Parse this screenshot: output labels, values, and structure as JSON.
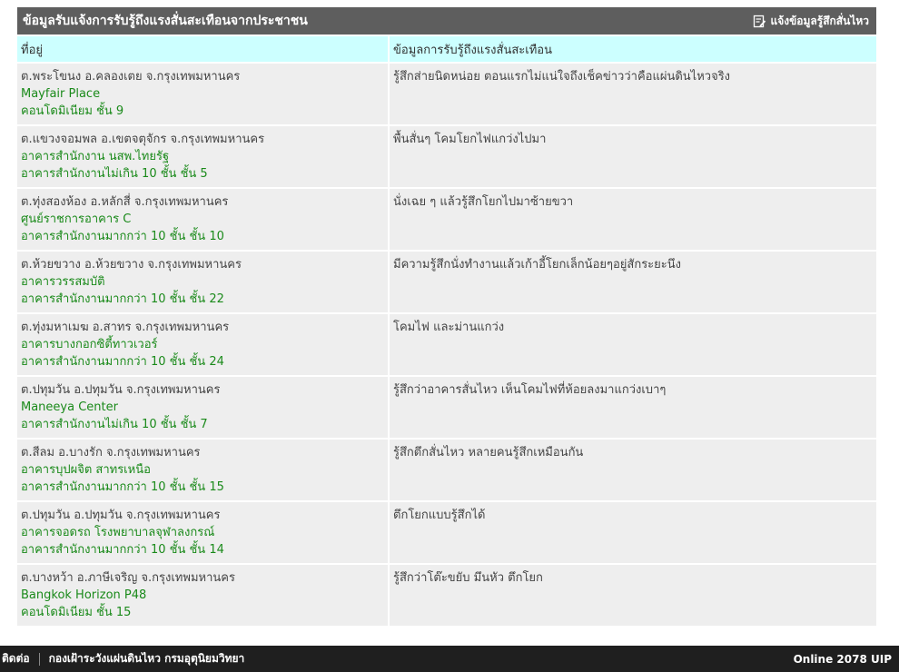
{
  "panel": {
    "title": "ข้อมูลรับแจ้งการรับรู้ถึงแรงสั่นสะเทือนจากประชาชน",
    "report_link_label": "แจ้งข้อมูลรู้สึกสั่นไหว",
    "report_link_icon": "edit-note-icon"
  },
  "table": {
    "headers": {
      "address": "ที่อยู่",
      "info": "ข้อมูลการรับรู้ถึงแรงสั่นสะเทือน"
    },
    "rows": [
      {
        "district": "ต.พระโขนง อ.คลองเตย จ.กรุงเทพมหานคร",
        "building": "Mayfair Place",
        "floor": "คอนโดมิเนียม ชั้น 9",
        "info": "รู้สึกส่ายนิดหน่อย ตอนแรกไม่แน่ใจถึงเช็คข่าวว่าคือแผ่นดินไหวจริง"
      },
      {
        "district": "ต.แขวงจอมพล อ.เขตจตุจักร จ.กรุงเทพมหานคร",
        "building": "อาคารสำนักงาน นสพ.ไทยรัฐ",
        "floor": "อาคารสำนักงานไม่เกิน 10 ชั้น ชั้น 5",
        "info": "พื้นสั่นๆ โคมโยกไฟแกว่งไปมา"
      },
      {
        "district": "ต.ทุ่งสองห้อง อ.หลักสี่ จ.กรุงเทพมหานคร",
        "building": "ศูนย์ราชการอาคาร C",
        "floor": "อาคารสำนักงานมากกว่า 10 ชั้น ชั้น 10",
        "info": "นั่งเฉย ๆ แล้วรู้สึกโยกไปมาซ้ายขวา"
      },
      {
        "district": "ต.ห้วยขวาง อ.ห้วยขวาง จ.กรุงเทพมหานคร",
        "building": "อาคารวรรสมบัติ",
        "floor": "อาคารสำนักงานมากกว่า 10 ชั้น ชั้น 22",
        "info": "มีความรู้สึกนั่งทำงานแล้วเก้าอี้โยกเล็กน้อยๆอยู่สักระยะนึง"
      },
      {
        "district": "ต.ทุ่งมหาเมฆ อ.สาทร จ.กรุงเทพมหานคร",
        "building": "อาคารบางกอกซิตี้ทาวเวอร์",
        "floor": "อาคารสำนักงานมากกว่า 10 ชั้น ชั้น 24",
        "info": "โคมไฟ และม่านแกว่ง"
      },
      {
        "district": "ต.ปทุมวัน อ.ปทุมวัน จ.กรุงเทพมหานคร",
        "building": "Maneeya Center",
        "floor": "อาคารสำนักงานไม่เกิน 10 ชั้น ชั้น 7",
        "info": "รู้สึกว่าอาคารสั่นไหว เห็นโคมไฟที่ห้อยลงมาแกว่งเบาๆ"
      },
      {
        "district": "ต.สีลม อ.บางรัก จ.กรุงเทพมหานคร",
        "building": "อาคารบุปผจิต สาทรเหนือ",
        "floor": "อาคารสำนักงานมากกว่า 10 ชั้น ชั้น 15",
        "info": "รู้สึกตึกสั่นไหว หลายคนรู้สึกเหมือนกัน"
      },
      {
        "district": "ต.ปทุมวัน อ.ปทุมวัน จ.กรุงเทพมหานคร",
        "building": "อาคารจอดรถ โรงพยาบาลจุฬาลงกรณ์",
        "floor": "อาคารสำนักงานมากกว่า 10 ชั้น ชั้น 14",
        "info": "ตึกโยกแบบรู้สึกได้"
      },
      {
        "district": "ต.บางหว้า อ.ภาษีเจริญ จ.กรุงเทพมหานคร",
        "building": "Bangkok Horizon P48",
        "floor": "คอนโดมิเนียม ชั้น 15",
        "info": "รู้สึกว่าโต๊ะขยับ มึนหัว ตึกโยก"
      }
    ]
  },
  "footer": {
    "contact_label": "ติดต่อ",
    "org_label": "กองเฝ้าระวังแผ่นดินไหว กรมอุตุนิยมวิทยา",
    "online_status": "Online 2078 UIP"
  },
  "colors": {
    "title_bar": "#5e5e5e",
    "header_row": "#ccffff",
    "row_bg": "#eeeeee",
    "building_text": "#1a8a1a",
    "footer_bg": "#1f1f1f"
  }
}
